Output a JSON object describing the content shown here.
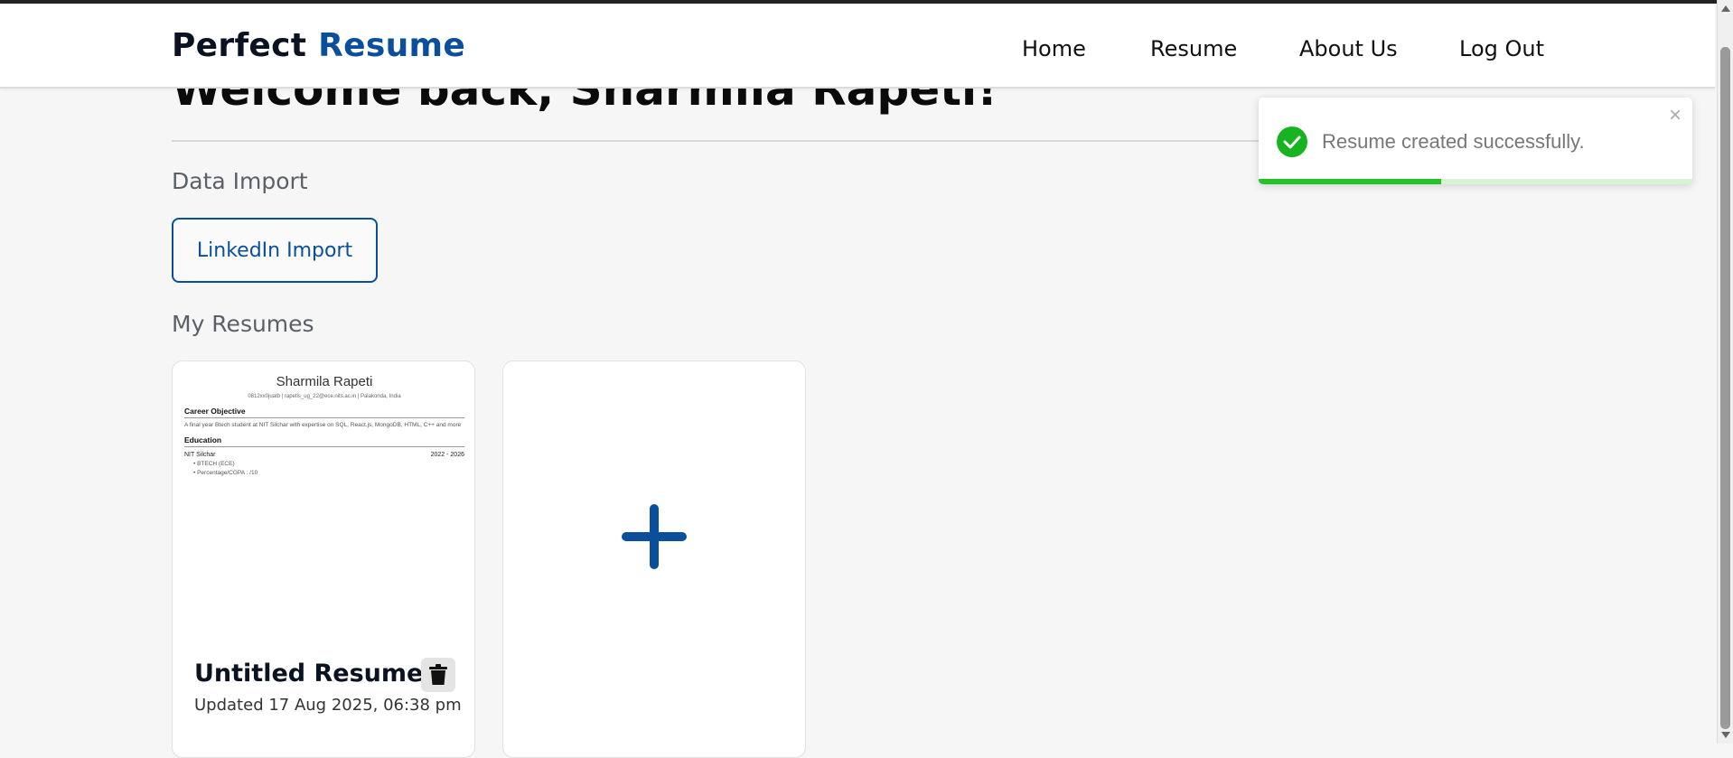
{
  "brand": {
    "part1": "Perfect",
    "part2": "Resume"
  },
  "nav": {
    "items": [
      "Home",
      "Resume",
      "About Us",
      "Log Out"
    ]
  },
  "welcome": "Welcome back, Sharmila Rapeti!",
  "data_import": {
    "heading": "Data Import",
    "linkedin_button": "LinkedIn Import"
  },
  "my_resumes": {
    "heading": "My Resumes",
    "cards": [
      {
        "title": "Untitled Resume",
        "updated": "Updated 17 Aug 2025, 06:38 pm",
        "preview": {
          "name": "Sharmila Rapeti",
          "contact": "0812xx0juatb | rapetis_ug_22@ece.nits.ac.in | Palakonda, India",
          "objective_heading": "Career Objective",
          "objective_text": "A final year Btech student at NIT Silchar with expertise on SQL, React.js, MongoDB, HTML, C++ and more",
          "education_heading": "Education",
          "institution": "NIT Silchar",
          "years": "2022 - 2026",
          "bullets": [
            "BTECH (ECE)",
            "Percentage/CGPA : /10"
          ]
        }
      }
    ]
  },
  "toast": {
    "message": "Resume created successfully.",
    "progress": 0.42,
    "close": "×"
  },
  "colors": {
    "brand_blue": "#0a4f9c",
    "success_green": "#25c22c"
  }
}
